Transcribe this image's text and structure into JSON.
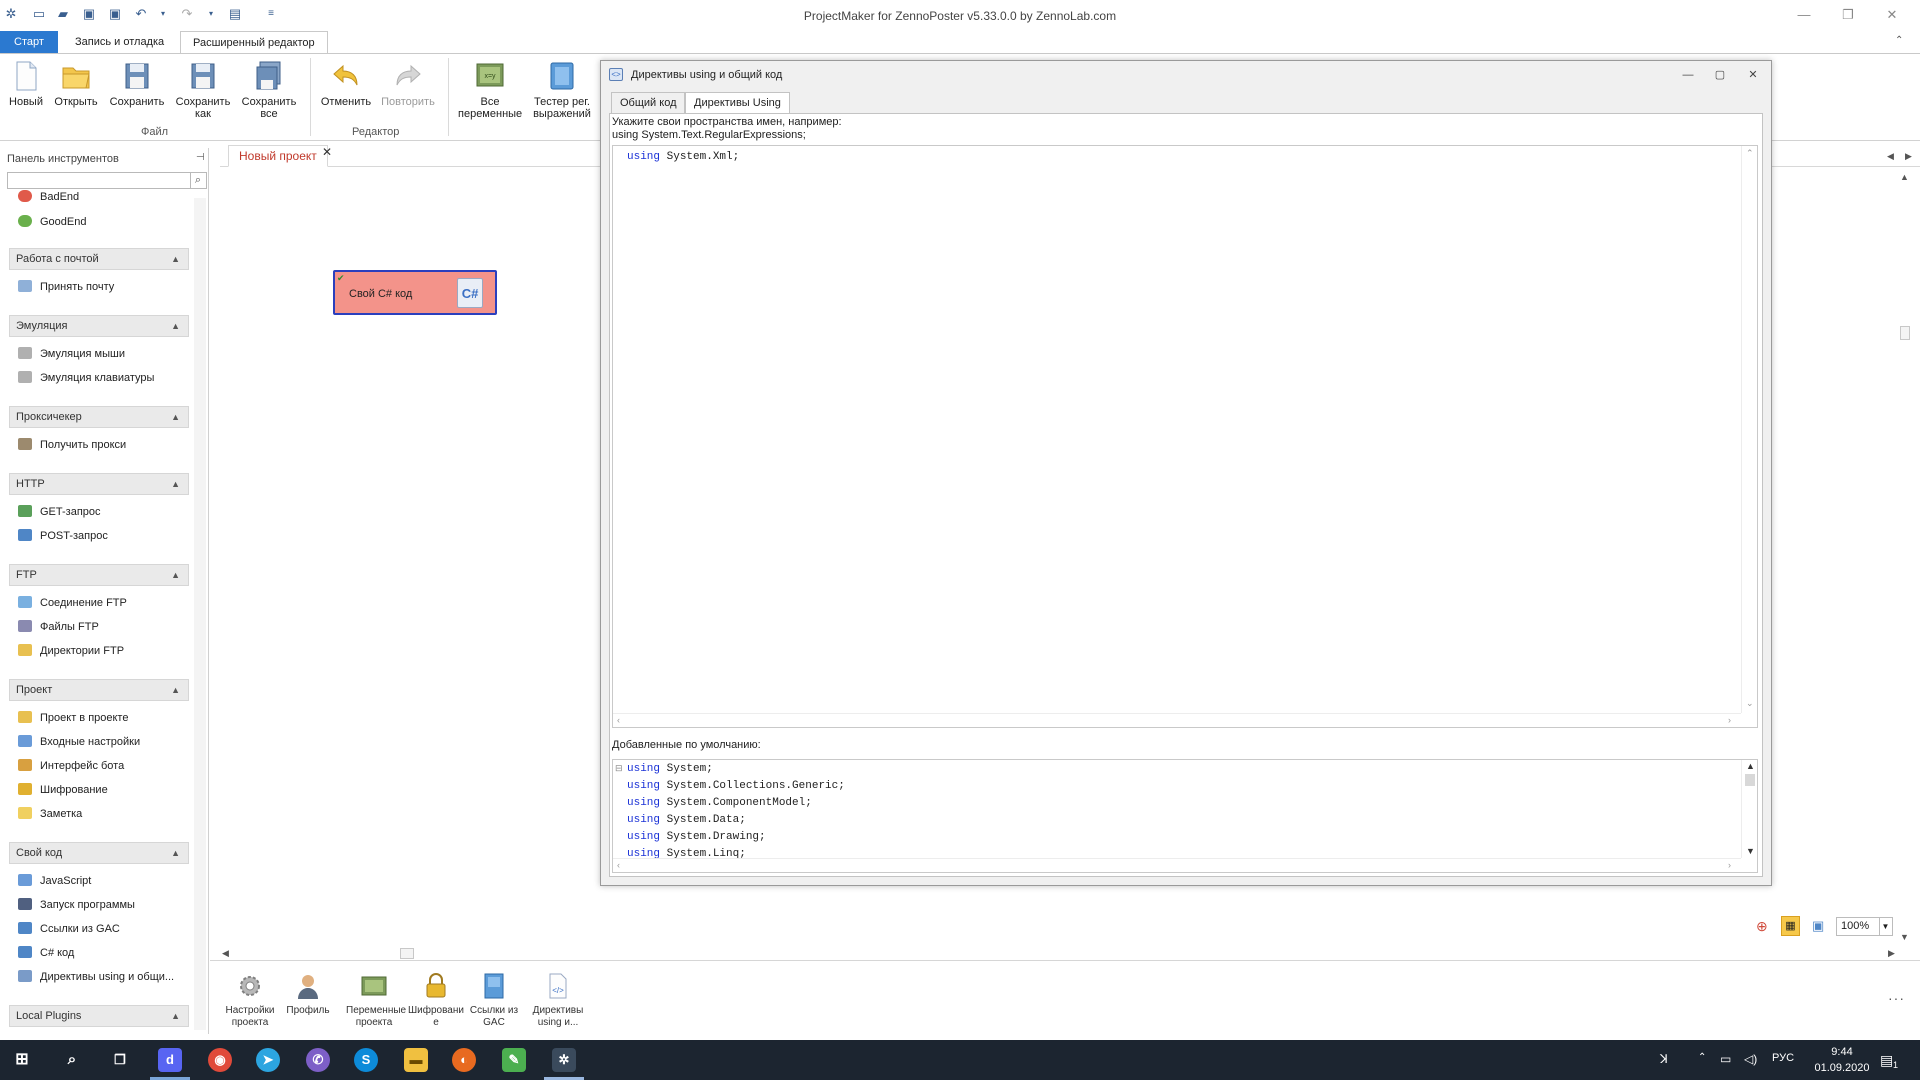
{
  "window": {
    "title": "ProjectMaker for ZennoPoster v5.33.0.0 by ZennoLab.com",
    "controls": [
      "—",
      "❐",
      "✕"
    ]
  },
  "ribbon": {
    "tabs": [
      {
        "label": "Старт",
        "state": "start"
      },
      {
        "label": "Запись и отладка",
        "state": "normal"
      },
      {
        "label": "Расширенный редактор",
        "state": "active"
      }
    ],
    "file_group": {
      "label": "Файл",
      "buttons": [
        {
          "name": "new",
          "label": "Новый"
        },
        {
          "name": "open",
          "label": "Открыть"
        },
        {
          "name": "save",
          "label": "Сохранить"
        },
        {
          "name": "save-as",
          "label": "Сохранить как"
        },
        {
          "name": "save-all",
          "label": "Сохранить все"
        }
      ]
    },
    "editor_group": {
      "label": "Редактор",
      "buttons": [
        {
          "name": "undo",
          "label": "Отменить"
        },
        {
          "name": "redo",
          "label": "Повторить",
          "disabled": true
        }
      ]
    },
    "other_buttons": [
      {
        "name": "all-variables",
        "label": "Все переменные"
      },
      {
        "name": "regex-tester",
        "label": "Тестер рег. выражений"
      }
    ]
  },
  "left_panel": {
    "title": "Панель инструментов",
    "search_placeholder": "",
    "partial_item": "BadEnd",
    "sections": [
      {
        "title": "",
        "items": [
          {
            "label": "GoodEnd",
            "icon": "good-end-icon",
            "color": "#6ab04c"
          }
        ]
      },
      {
        "title": "Работа с почтой",
        "items": [
          {
            "label": "Принять почту",
            "icon": "mail-icon",
            "color": "#8fb0d8"
          }
        ]
      },
      {
        "title": "Эмуляция",
        "items": [
          {
            "label": "Эмуляция мыши",
            "icon": "mouse-icon",
            "color": "#b0b0b0"
          },
          {
            "label": "Эмуляция клавиатуры",
            "icon": "keyboard-icon",
            "color": "#b0b0b0"
          }
        ]
      },
      {
        "title": "Проксичекер",
        "items": [
          {
            "label": "Получить прокси",
            "icon": "proxy-icon",
            "color": "#9c8a6e"
          }
        ]
      },
      {
        "title": "HTTP",
        "items": [
          {
            "label": "GET-запрос",
            "icon": "get-request-icon",
            "color": "#5aa05a"
          },
          {
            "label": "POST-запрос",
            "icon": "post-request-icon",
            "color": "#4f86c6"
          }
        ]
      },
      {
        "title": "FTP",
        "items": [
          {
            "label": "Соединение FTP",
            "icon": "ftp-connection-icon",
            "color": "#7ab0e0"
          },
          {
            "label": "Файлы FTP",
            "icon": "ftp-files-icon",
            "color": "#8a8ab0"
          },
          {
            "label": "Директории FTP",
            "icon": "ftp-dirs-icon",
            "color": "#e8c050"
          }
        ]
      },
      {
        "title": "Проект",
        "items": [
          {
            "label": "Проект в проекте",
            "icon": "project-icon",
            "color": "#e8c050"
          },
          {
            "label": "Входные настройки",
            "icon": "input-settings-icon",
            "color": "#6a9bd8"
          },
          {
            "label": "Интерфейс бота",
            "icon": "bot-interface-icon",
            "color": "#d8a040"
          },
          {
            "label": "Шифрование",
            "icon": "lock-icon",
            "color": "#e0b030"
          },
          {
            "label": "Заметка",
            "icon": "note-icon",
            "color": "#f0d060"
          }
        ]
      },
      {
        "title": "Свой код",
        "items": [
          {
            "label": "JavaScript",
            "icon": "javascript-icon",
            "color": "#6a9bd8"
          },
          {
            "label": "Запуск программы",
            "icon": "run-program-icon",
            "color": "#506080"
          },
          {
            "label": "Ссылки из GAC",
            "icon": "gac-icon",
            "color": "#4f86c6"
          },
          {
            "label": "C# код",
            "icon": "csharp-icon",
            "color": "#4f86c6"
          },
          {
            "label": "Директивы using и общи...",
            "icon": "using-directives-icon",
            "color": "#7a9bc8"
          }
        ]
      },
      {
        "title": "Local Plugins",
        "items": []
      }
    ]
  },
  "document": {
    "tab_label": "Новый проект",
    "block_label": "Свой C# код",
    "zoom": "100%"
  },
  "bottom_toolbar": [
    {
      "name": "project-settings",
      "label": "Настройки проекта",
      "icon": "gear-icon"
    },
    {
      "name": "profile",
      "label": "Профиль",
      "icon": "profile-icon"
    },
    {
      "name": "project-variables",
      "label": "Переменные проекта",
      "icon": "variables-icon"
    },
    {
      "name": "encryption",
      "label": "Шифровани е",
      "icon": "lock-icon"
    },
    {
      "name": "gac-links",
      "label": "Ссылки из GAC",
      "icon": "gac-icon"
    },
    {
      "name": "using-directives",
      "label": "Директивы using и...",
      "icon": "using-directives-icon"
    }
  ],
  "dialog": {
    "title": "Директивы using и общий код",
    "tabs": [
      {
        "label": "Общий код",
        "active": false
      },
      {
        "label": "Директивы Using",
        "active": true
      }
    ],
    "hint_line1": "Укажите свои пространства имен, например:",
    "hint_line2": "using System.Text.RegularExpressions;",
    "user_code": [
      {
        "kw": "using",
        "rest": " System.Xml;"
      }
    ],
    "default_label": "Добавленные по умолчанию:",
    "default_code": [
      {
        "kw": "using",
        "rest": " System;"
      },
      {
        "kw": "using",
        "rest": " System.Collections.Generic;"
      },
      {
        "kw": "using",
        "rest": " System.ComponentModel;"
      },
      {
        "kw": "using",
        "rest": " System.Data;"
      },
      {
        "kw": "using",
        "rest": " System.Drawing;"
      },
      {
        "kw": "using",
        "rest": " System.Linq;"
      }
    ]
  },
  "taskbar": {
    "apps": [
      "start",
      "search",
      "task-view",
      "discord",
      "chrome",
      "telegram",
      "viber",
      "skype",
      "explorer",
      "firefox",
      "notepad",
      "zennoposter"
    ],
    "language": "РУС",
    "time": "9:44",
    "date": "01.09.2020",
    "notification_count": "1"
  }
}
